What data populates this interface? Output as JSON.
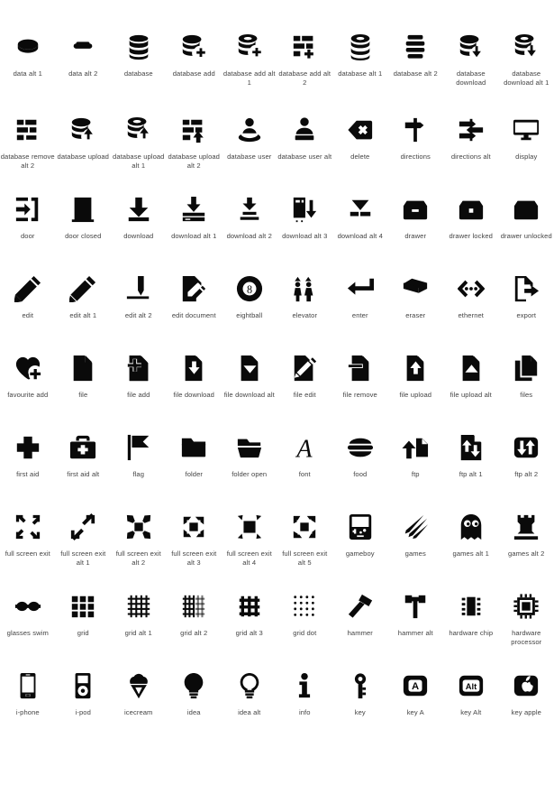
{
  "sheet": {
    "title": "Icon set contact sheet",
    "columns": 10,
    "rows": 10,
    "label_color": "#444444",
    "icon_color": "#0a0a0a",
    "background_color": "#ffffff"
  },
  "icons": [
    [
      {
        "name": "data-alt-1-icon",
        "label": "data alt 1",
        "glyph": "disk"
      },
      {
        "name": "data-alt-2-icon",
        "label": "data alt 2",
        "glyph": "disk-flat"
      },
      {
        "name": "database-icon",
        "label": "database",
        "glyph": "db"
      },
      {
        "name": "database-add-icon",
        "label": "database add",
        "glyph": "db-plus"
      },
      {
        "name": "database-add-alt-1-icon",
        "label": "database add alt 1",
        "glyph": "db-ring-plus"
      },
      {
        "name": "database-add-alt-2-icon",
        "label": "database add alt 2",
        "glyph": "bars-plus"
      },
      {
        "name": "database-alt-1-icon",
        "label": "database alt 1",
        "glyph": "db-ring"
      },
      {
        "name": "database-alt-2-icon",
        "label": "database alt 2",
        "glyph": "bars-stack"
      },
      {
        "name": "database-download-icon",
        "label": "database download",
        "glyph": "db-down"
      },
      {
        "name": "database-download-alt-1-icon",
        "label": "database download alt 1",
        "glyph": "db-ring-down"
      }
    ],
    [
      {
        "name": "database-remove-alt-2-icon",
        "label": "database remove alt 2",
        "glyph": "bars-minus"
      },
      {
        "name": "database-upload-icon",
        "label": "database upload",
        "glyph": "db-up"
      },
      {
        "name": "database-upload-alt-1-icon",
        "label": "database upload alt 1",
        "glyph": "db-ring-up"
      },
      {
        "name": "database-upload-alt-2-icon",
        "label": "database upload alt 2",
        "glyph": "bars-up"
      },
      {
        "name": "database-user-icon",
        "label": "database user",
        "glyph": "db-user"
      },
      {
        "name": "database-user-alt-icon",
        "label": "database user alt",
        "glyph": "user-block"
      },
      {
        "name": "delete-icon",
        "label": "delete",
        "glyph": "backspace"
      },
      {
        "name": "directions-icon",
        "label": "directions",
        "glyph": "signpost"
      },
      {
        "name": "directions-alt-icon",
        "label": "directions alt",
        "glyph": "signpost-alt"
      },
      {
        "name": "display-icon",
        "label": "display",
        "glyph": "monitor"
      }
    ],
    [
      {
        "name": "door-icon",
        "label": "door",
        "glyph": "door-enter"
      },
      {
        "name": "door-closed-icon",
        "label": "door closed",
        "glyph": "door-closed"
      },
      {
        "name": "download-icon",
        "label": "download",
        "glyph": "download-tray"
      },
      {
        "name": "download-alt-1-icon",
        "label": "download alt 1",
        "glyph": "download-drive"
      },
      {
        "name": "download-alt-2-icon",
        "label": "download alt 2",
        "glyph": "download-lines"
      },
      {
        "name": "download-alt-3-icon",
        "label": "download alt 3",
        "glyph": "download-tower"
      },
      {
        "name": "download-alt-4-icon",
        "label": "download alt 4",
        "glyph": "download-bar"
      },
      {
        "name": "drawer-icon",
        "label": "drawer",
        "glyph": "drawer"
      },
      {
        "name": "drawer-locked-icon",
        "label": "drawer locked",
        "glyph": "drawer-locked"
      },
      {
        "name": "drawer-unlocked-icon",
        "label": "drawer unlocked",
        "glyph": "drawer-unlocked"
      }
    ],
    [
      {
        "name": "edit-icon",
        "label": "edit",
        "glyph": "pencil"
      },
      {
        "name": "edit-alt-1-icon",
        "label": "edit alt 1",
        "glyph": "pencil-alt"
      },
      {
        "name": "edit-alt-2-icon",
        "label": "edit alt 2",
        "glyph": "pen-line"
      },
      {
        "name": "edit-document-icon",
        "label": "edit document",
        "glyph": "doc-pencil"
      },
      {
        "name": "eightball-icon",
        "label": "eightball",
        "glyph": "eightball"
      },
      {
        "name": "elevator-icon",
        "label": "elevator",
        "glyph": "elevator"
      },
      {
        "name": "enter-icon",
        "label": "enter",
        "glyph": "enter-arrow"
      },
      {
        "name": "eraser-icon",
        "label": "eraser",
        "glyph": "eraser"
      },
      {
        "name": "ethernet-icon",
        "label": "ethernet",
        "glyph": "ethernet"
      },
      {
        "name": "export-icon",
        "label": "export",
        "glyph": "doc-export"
      }
    ],
    [
      {
        "name": "favourite-add-icon",
        "label": "favourite add",
        "glyph": "heart-plus"
      },
      {
        "name": "file-icon",
        "label": "file",
        "glyph": "file"
      },
      {
        "name": "file-add-icon",
        "label": "file add",
        "glyph": "file-plus"
      },
      {
        "name": "file-download-icon",
        "label": "file download",
        "glyph": "file-down"
      },
      {
        "name": "file-download-alt-icon",
        "label": "file download alt",
        "glyph": "file-down-alt"
      },
      {
        "name": "file-edit-icon",
        "label": "file edit",
        "glyph": "file-pencil"
      },
      {
        "name": "file-remove-icon",
        "label": "file remove",
        "glyph": "file-minus"
      },
      {
        "name": "file-upload-icon",
        "label": "file upload",
        "glyph": "file-up"
      },
      {
        "name": "file-upload-alt-icon",
        "label": "file upload alt",
        "glyph": "file-up-alt"
      },
      {
        "name": "files-icon",
        "label": "files",
        "glyph": "files"
      }
    ],
    [
      {
        "name": "first-aid-icon",
        "label": "first aid",
        "glyph": "cross"
      },
      {
        "name": "first-aid-alt-icon",
        "label": "first aid alt",
        "glyph": "medkit"
      },
      {
        "name": "flag-icon",
        "label": "flag",
        "glyph": "flag"
      },
      {
        "name": "folder-icon",
        "label": "folder",
        "glyph": "folder"
      },
      {
        "name": "folder-open-icon",
        "label": "folder open",
        "glyph": "folder-open"
      },
      {
        "name": "font-icon",
        "label": "font",
        "glyph": "font-a"
      },
      {
        "name": "food-icon",
        "label": "food",
        "glyph": "burger"
      },
      {
        "name": "ftp-icon",
        "label": "ftp",
        "glyph": "ftp"
      },
      {
        "name": "ftp-alt-1-icon",
        "label": "ftp alt 1",
        "glyph": "ftp-alt1"
      },
      {
        "name": "ftp-alt-2-icon",
        "label": "ftp alt 2",
        "glyph": "ftp-alt2"
      }
    ],
    [
      {
        "name": "full-screen-exit-icon",
        "label": "full screen exit",
        "glyph": "fs-exit"
      },
      {
        "name": "full-screen-exit-alt-1-icon",
        "label": "full screen exit alt 1",
        "glyph": "fs-exit-1"
      },
      {
        "name": "full-screen-exit-alt-2-icon",
        "label": "full screen exit alt 2",
        "glyph": "fs-exit-2"
      },
      {
        "name": "full-screen-exit-alt-3-icon",
        "label": "full screen exit alt 3",
        "glyph": "fs-exit-3"
      },
      {
        "name": "full-screen-exit-alt-4-icon",
        "label": "full screen exit alt 4",
        "glyph": "fs-exit-4"
      },
      {
        "name": "full-screen-exit-alt-5-icon",
        "label": "full screen exit alt 5",
        "glyph": "fs-exit-5"
      },
      {
        "name": "gameboy-icon",
        "label": "gameboy",
        "glyph": "gameboy"
      },
      {
        "name": "games-icon",
        "label": "games",
        "glyph": "darts"
      },
      {
        "name": "games-alt-1-icon",
        "label": "games alt 1",
        "glyph": "ghost"
      },
      {
        "name": "games-alt-2-icon",
        "label": "games alt 2",
        "glyph": "rook"
      }
    ],
    [
      {
        "name": "glasses-swim-icon",
        "label": "glasses swim",
        "glyph": "goggles"
      },
      {
        "name": "grid-icon",
        "label": "grid",
        "glyph": "grid-blocks"
      },
      {
        "name": "grid-alt-1-icon",
        "label": "grid alt 1",
        "glyph": "grid-lines"
      },
      {
        "name": "grid-alt-2-icon",
        "label": "grid alt 2",
        "glyph": "grid-vert"
      },
      {
        "name": "grid-alt-3-icon",
        "label": "grid alt 3",
        "glyph": "grid-bold"
      },
      {
        "name": "grid-dot-icon",
        "label": "grid dot",
        "glyph": "grid-dot"
      },
      {
        "name": "hammer-icon",
        "label": "hammer",
        "glyph": "hammer"
      },
      {
        "name": "hammer-alt-icon",
        "label": "hammer alt",
        "glyph": "hammer-alt"
      },
      {
        "name": "hardware-chip-icon",
        "label": "hardware chip",
        "glyph": "chip"
      },
      {
        "name": "hardware-processor-icon",
        "label": "hardware processor",
        "glyph": "cpu"
      }
    ],
    [
      {
        "name": "i-phone-icon",
        "label": "i-phone",
        "glyph": "iphone"
      },
      {
        "name": "i-pod-icon",
        "label": "i-pod",
        "glyph": "ipod"
      },
      {
        "name": "icecream-icon",
        "label": "icecream",
        "glyph": "icecream"
      },
      {
        "name": "idea-icon",
        "label": "idea",
        "glyph": "bulb"
      },
      {
        "name": "idea-alt-icon",
        "label": "idea alt",
        "glyph": "bulb-outline"
      },
      {
        "name": "info-icon",
        "label": "info",
        "glyph": "info"
      },
      {
        "name": "key-icon",
        "label": "key",
        "glyph": "key"
      },
      {
        "name": "key-a-icon",
        "label": "key A",
        "glyph": "key-a"
      },
      {
        "name": "key-alt-icon",
        "label": "key Alt",
        "glyph": "key-alt"
      },
      {
        "name": "key-apple-icon",
        "label": "key apple",
        "glyph": "key-apple"
      }
    ]
  ]
}
